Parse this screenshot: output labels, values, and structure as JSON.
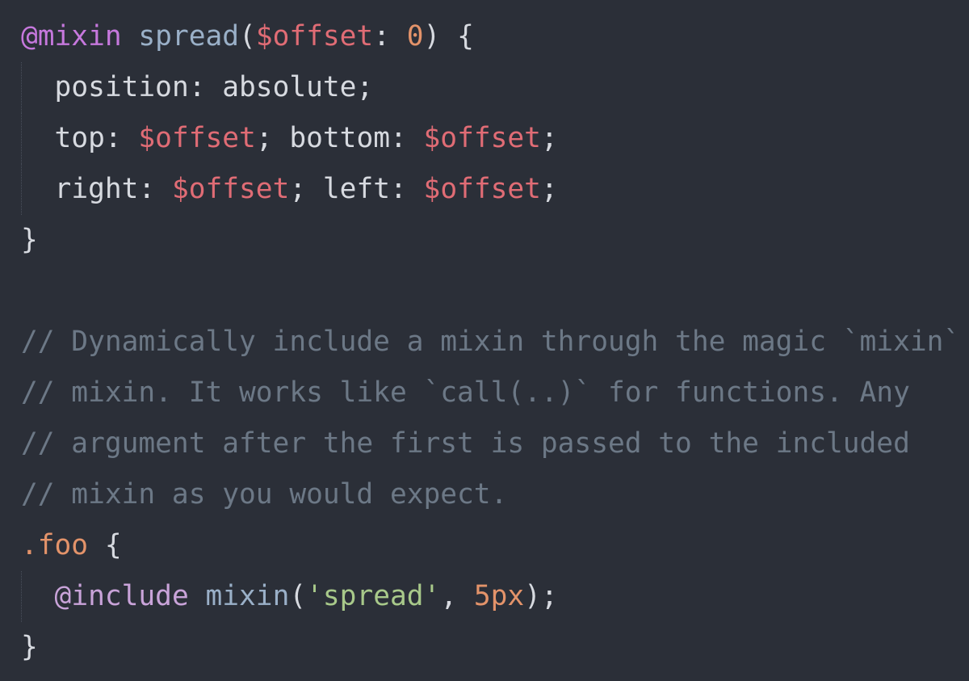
{
  "editor": {
    "background": "#2b2f38",
    "colors": {
      "keyword": "#c678dd",
      "function": "#9ab0c8",
      "variable": "#e06c75",
      "number": "#e3936a",
      "text": "#d7dae0",
      "comment": "#6c7886",
      "string": "#a8c98a"
    },
    "lines": [
      {
        "id": "line-1",
        "tokens": [
          {
            "t": "@mixin",
            "c": "tok-at"
          },
          {
            "t": " ",
            "c": "tok-punc"
          },
          {
            "t": "spread",
            "c": "tok-fn"
          },
          {
            "t": "(",
            "c": "tok-punc"
          },
          {
            "t": "$offset",
            "c": "tok-var"
          },
          {
            "t": ": ",
            "c": "tok-punc"
          },
          {
            "t": "0",
            "c": "tok-num"
          },
          {
            "t": ") {",
            "c": "tok-punc"
          }
        ]
      },
      {
        "id": "line-2",
        "indent": true,
        "tokens": [
          {
            "t": "position",
            "c": "tok-prop"
          },
          {
            "t": ": ",
            "c": "tok-punc"
          },
          {
            "t": "absolute",
            "c": "tok-val"
          },
          {
            "t": ";",
            "c": "tok-punc"
          }
        ]
      },
      {
        "id": "line-3",
        "indent": true,
        "tokens": [
          {
            "t": "top",
            "c": "tok-prop"
          },
          {
            "t": ": ",
            "c": "tok-punc"
          },
          {
            "t": "$offset",
            "c": "tok-var"
          },
          {
            "t": "; ",
            "c": "tok-punc"
          },
          {
            "t": "bottom",
            "c": "tok-prop"
          },
          {
            "t": ": ",
            "c": "tok-punc"
          },
          {
            "t": "$offset",
            "c": "tok-var"
          },
          {
            "t": ";",
            "c": "tok-punc"
          }
        ]
      },
      {
        "id": "line-4",
        "indent": true,
        "tokens": [
          {
            "t": "right",
            "c": "tok-prop"
          },
          {
            "t": ": ",
            "c": "tok-punc"
          },
          {
            "t": "$offset",
            "c": "tok-var"
          },
          {
            "t": "; ",
            "c": "tok-punc"
          },
          {
            "t": "left",
            "c": "tok-prop"
          },
          {
            "t": ": ",
            "c": "tok-punc"
          },
          {
            "t": "$offset",
            "c": "tok-var"
          },
          {
            "t": ";",
            "c": "tok-punc"
          }
        ]
      },
      {
        "id": "line-5",
        "tokens": [
          {
            "t": "}",
            "c": "tok-punc"
          }
        ]
      },
      {
        "id": "line-6",
        "tokens": []
      },
      {
        "id": "line-7",
        "tokens": [
          {
            "t": "// Dynamically include a mixin through the magic `mixin`",
            "c": "tok-comment"
          }
        ]
      },
      {
        "id": "line-8",
        "tokens": [
          {
            "t": "// mixin. It works like `call(..)` for functions. Any",
            "c": "tok-comment"
          }
        ]
      },
      {
        "id": "line-9",
        "tokens": [
          {
            "t": "// argument after the first is passed to the included",
            "c": "tok-comment"
          }
        ]
      },
      {
        "id": "line-10",
        "tokens": [
          {
            "t": "// mixin as you would expect.",
            "c": "tok-comment"
          }
        ]
      },
      {
        "id": "line-11",
        "tokens": [
          {
            "t": ".foo",
            "c": "tok-selector"
          },
          {
            "t": " {",
            "c": "tok-punc"
          }
        ]
      },
      {
        "id": "line-12",
        "indent": true,
        "tokens": [
          {
            "t": "@include",
            "c": "tok-include"
          },
          {
            "t": " ",
            "c": "tok-punc"
          },
          {
            "t": "mixin",
            "c": "tok-mixin-call"
          },
          {
            "t": "(",
            "c": "tok-punc"
          },
          {
            "t": "'spread'",
            "c": "tok-str"
          },
          {
            "t": ", ",
            "c": "tok-punc"
          },
          {
            "t": "5px",
            "c": "tok-num"
          },
          {
            "t": ");",
            "c": "tok-punc"
          }
        ]
      },
      {
        "id": "line-13",
        "tokens": [
          {
            "t": "}",
            "c": "tok-punc"
          }
        ]
      }
    ]
  }
}
